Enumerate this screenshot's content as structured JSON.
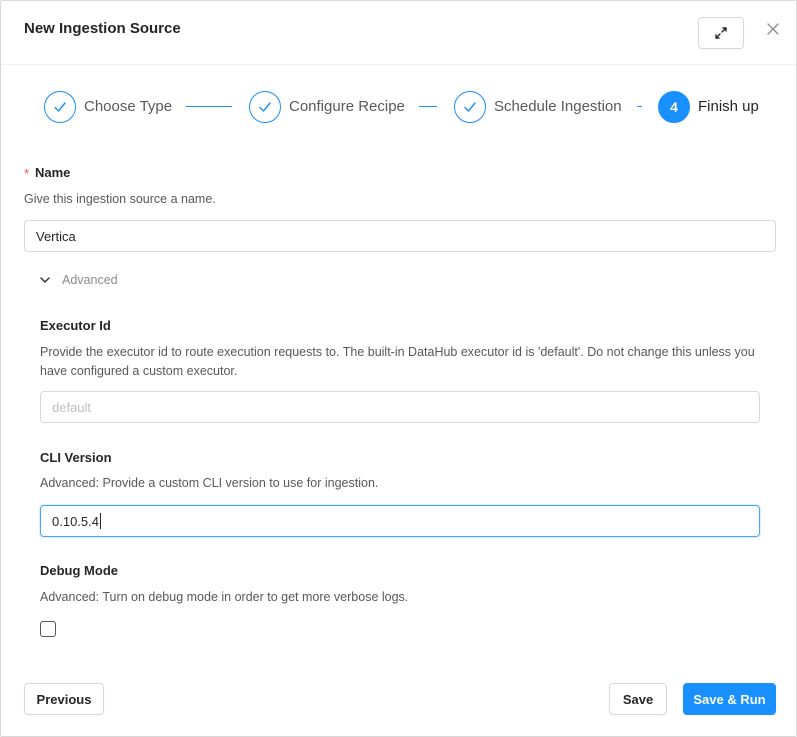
{
  "modal": {
    "title": "New Ingestion Source",
    "expand_icon": "expand-arrows-icon",
    "close_icon": "close-icon"
  },
  "steps": [
    {
      "label": "Choose Type",
      "status": "done"
    },
    {
      "label": "Configure Recipe",
      "status": "done"
    },
    {
      "label": "Schedule Ingestion",
      "status": "done"
    },
    {
      "label": "Finish up",
      "status": "active",
      "number": "4"
    }
  ],
  "name": {
    "required_mark": "*",
    "label": "Name",
    "help": "Give this ingestion source a name.",
    "value": "Vertica"
  },
  "advanced": {
    "toggle_label": "Advanced",
    "executor": {
      "label": "Executor Id",
      "help": "Provide the executor id to route execution requests to. The built-in DataHub executor id is 'default'. Do not change this unless you have configured a custom executor.",
      "placeholder": "default",
      "value": ""
    },
    "cli": {
      "label": "CLI Version",
      "help": "Advanced: Provide a custom CLI version to use for ingestion.",
      "value": "0.10.5.4"
    },
    "debug": {
      "label": "Debug Mode",
      "help": "Advanced: Turn on debug mode in order to get more verbose logs.",
      "checked": false
    }
  },
  "footer": {
    "previous_label": "Previous",
    "save_label": "Save",
    "save_run_label": "Save & Run"
  },
  "colors": {
    "accent": "#1890ff",
    "required": "#ff4d4f",
    "border": "#d9d9d9"
  }
}
